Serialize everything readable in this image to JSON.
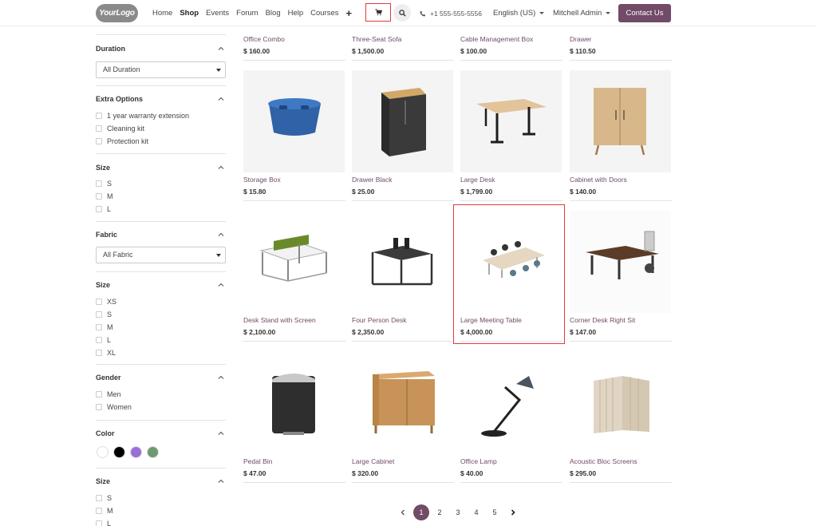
{
  "header": {
    "logo": "YourLogo",
    "nav": [
      "Home",
      "Shop",
      "Events",
      "Forum",
      "Blog",
      "Help",
      "Courses"
    ],
    "active_nav": "Shop",
    "plus": "+",
    "phone": "+1 555-555-5556",
    "language": "English (US)",
    "user": "Mitchell Admin",
    "contact": "Contact Us"
  },
  "filters": {
    "duration": {
      "title": "Duration",
      "value": "All Duration"
    },
    "extra_options": {
      "title": "Extra Options",
      "options": [
        "1 year warranty extension",
        "Cleaning kit",
        "Protection kit"
      ]
    },
    "size1": {
      "title": "Size",
      "options": [
        "S",
        "M",
        "L"
      ]
    },
    "fabric": {
      "title": "Fabric",
      "value": "All Fabric"
    },
    "size2": {
      "title": "Size",
      "options": [
        "XS",
        "S",
        "M",
        "L",
        "XL"
      ]
    },
    "gender": {
      "title": "Gender",
      "options": [
        "Men",
        "Women"
      ]
    },
    "color": {
      "title": "Color",
      "swatches": [
        "#ffffff",
        "#000000",
        "#9b6fd8",
        "#6f9a6f"
      ]
    },
    "size3": {
      "title": "Size",
      "options": [
        "S",
        "M",
        "L"
      ]
    }
  },
  "products_top": [
    {
      "name": "Office Combo",
      "price": "$ 160.00"
    },
    {
      "name": "Three-Seat Sofa",
      "price": "$ 1,500.00"
    },
    {
      "name": "Cable Management Box",
      "price": "$ 100.00"
    },
    {
      "name": "Drawer",
      "price": "$ 110.50"
    }
  ],
  "products": [
    {
      "name": "Storage Box",
      "price": "$ 15.80",
      "icon": "storage-box"
    },
    {
      "name": "Drawer Black",
      "price": "$ 25.00",
      "icon": "drawer-black"
    },
    {
      "name": "Large Desk",
      "price": "$ 1,799.00",
      "icon": "large-desk"
    },
    {
      "name": "Cabinet with Doors",
      "price": "$ 140.00",
      "icon": "cabinet-doors"
    },
    {
      "name": "Desk Stand with Screen",
      "price": "$ 2,100.00",
      "icon": "desk-screen"
    },
    {
      "name": "Four Person Desk",
      "price": "$ 2,350.00",
      "icon": "four-person-desk"
    },
    {
      "name": "Large Meeting Table",
      "price": "$ 4,000.00",
      "icon": "meeting-table"
    },
    {
      "name": "Corner Desk Right Sit",
      "price": "$ 147.00",
      "icon": "corner-desk"
    },
    {
      "name": "Pedal Bin",
      "price": "$ 47.00",
      "icon": "pedal-bin"
    },
    {
      "name": "Large Cabinet",
      "price": "$ 320.00",
      "icon": "large-cabinet"
    },
    {
      "name": "Office Lamp",
      "price": "$ 40.00",
      "icon": "office-lamp"
    },
    {
      "name": "Acoustic Bloc Screens",
      "price": "$ 295.00",
      "icon": "acoustic-screens"
    }
  ],
  "pagination": {
    "pages": [
      "1",
      "2",
      "3",
      "4",
      "5"
    ],
    "current": "1"
  }
}
